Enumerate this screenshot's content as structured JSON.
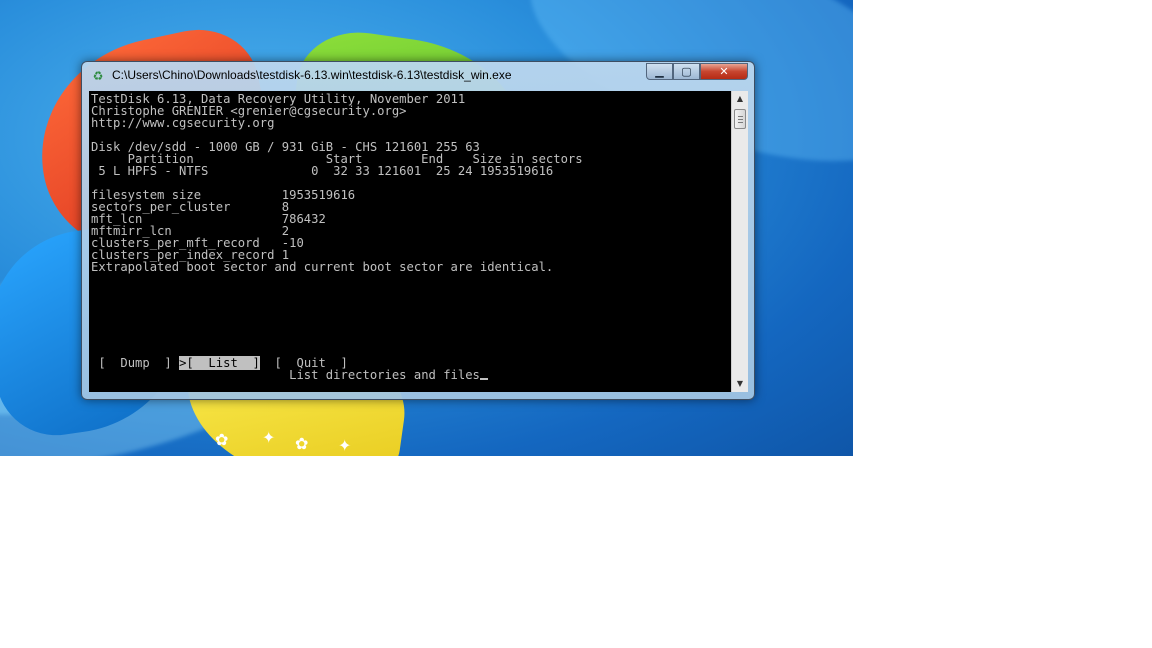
{
  "window": {
    "title": "C:\\Users\\Chino\\Downloads\\testdisk-6.13.win\\testdisk-6.13\\testdisk_win.exe",
    "icon": "testdisk-app-icon",
    "controls": {
      "minimize_icon": "minimize-icon",
      "maximize_icon": "maximize-icon",
      "close_icon": "close-icon"
    }
  },
  "console": {
    "header": [
      "TestDisk 6.13, Data Recovery Utility, November 2011",
      "Christophe GRENIER <grenier@cgsecurity.org>",
      "http://www.cgsecurity.org"
    ],
    "disk_line": "Disk /dev/sdd - 1000 GB / 931 GiB - CHS 121601 255 63",
    "partition_header": "     Partition                  Start        End    Size in sectors",
    "partition_row": " 5 L HPFS - NTFS              0  32 33 121601  25 24 1953519616",
    "fields": [
      "filesystem size           1953519616",
      "sectors_per_cluster       8",
      "mft_lcn                   786432",
      "mftmirr_lcn               2",
      "clusters_per_mft_record   -10",
      "clusters_per_index_record 1"
    ],
    "message": "Extrapolated boot sector and current boot sector are identical.",
    "menu": {
      "leading": " [  ",
      "dump": "Dump",
      "dump_close": "  ] ",
      "list_selected": ">[  List  ]",
      "gap": "  [  ",
      "quit": "Quit",
      "quit_close": "  ]"
    },
    "prompt_indent": "                           ",
    "hint": "List directories and files"
  },
  "colors": {
    "console_bg": "#000000",
    "console_fg": "#c0c0c0",
    "close_button": "#c7452f"
  }
}
